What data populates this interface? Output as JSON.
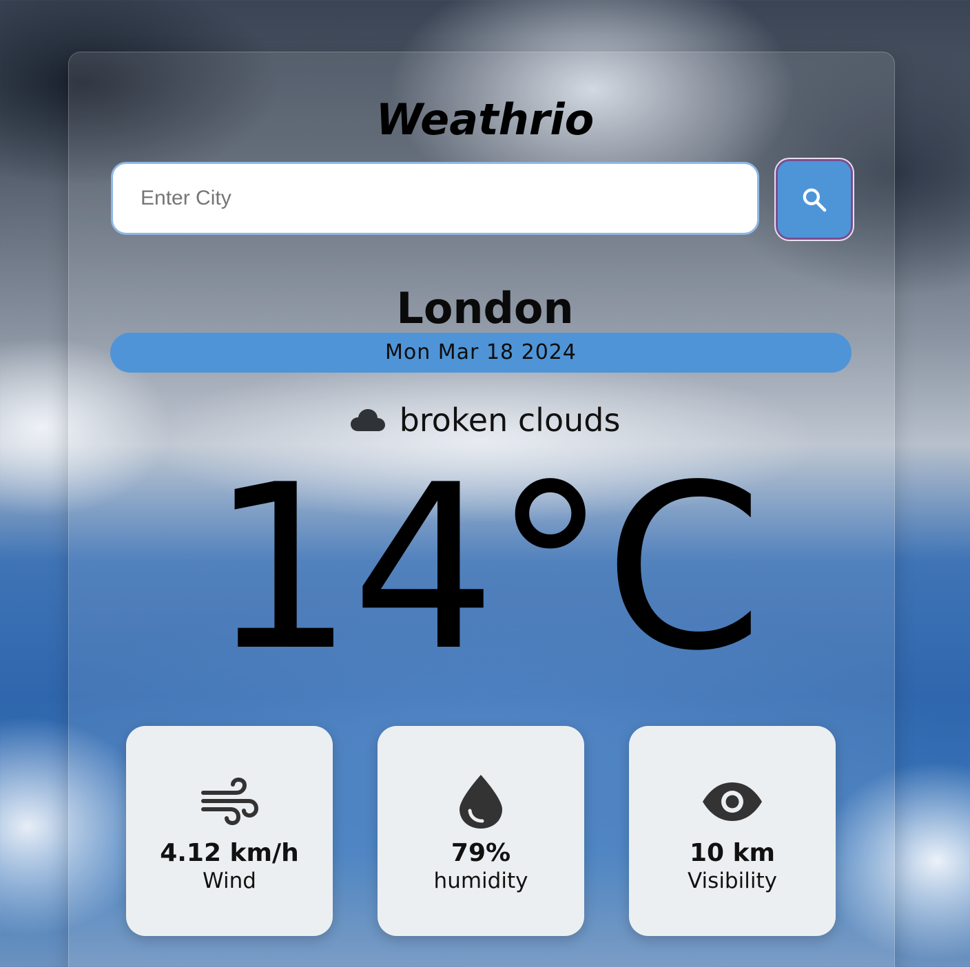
{
  "app": {
    "title": "Weathrio"
  },
  "search": {
    "placeholder": "Enter City",
    "value": "",
    "button_icon": "search-icon"
  },
  "weather": {
    "city": "London",
    "date": "Mon Mar 18 2024",
    "condition_icon": "cloud-icon",
    "condition": "broken clouds",
    "temperature": "14°C"
  },
  "stats": [
    {
      "icon": "wind-icon",
      "value": "4.12 km/h",
      "label": "Wind"
    },
    {
      "icon": "water-drop-icon",
      "value": "79%",
      "label": "humidity"
    },
    {
      "icon": "eye-icon",
      "value": "10 km",
      "label": "Visibility"
    }
  ],
  "colors": {
    "accent": "#4f94d6",
    "card_background": "#eceff1",
    "search_button_border": "#7a4f8f"
  }
}
